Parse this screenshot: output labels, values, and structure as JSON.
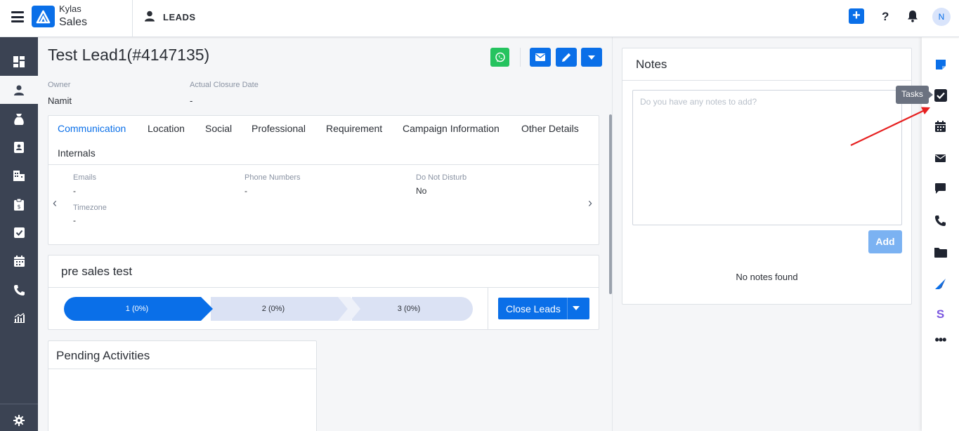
{
  "topbar": {
    "brand_line1": "Kylas",
    "brand_line2": "Sales",
    "module": "LEADS",
    "avatar_initial": "N"
  },
  "lead": {
    "title": "Test Lead1(#4147135)",
    "fields": [
      {
        "label": "Owner",
        "value": "Namit"
      },
      {
        "label": "Actual Closure Date",
        "value": "-"
      }
    ]
  },
  "tabs": [
    {
      "label": "Communication",
      "active": true
    },
    {
      "label": "Location"
    },
    {
      "label": "Social"
    },
    {
      "label": "Professional"
    },
    {
      "label": "Requirement"
    },
    {
      "label": "Campaign Information"
    },
    {
      "label": "Other Details"
    },
    {
      "label": "Internals"
    }
  ],
  "communication": [
    {
      "label": "Emails",
      "value": "-"
    },
    {
      "label": "Phone Numbers",
      "value": "-"
    },
    {
      "label": "Do Not Disturb",
      "value": "No"
    },
    {
      "label": "Timezone",
      "value": "-"
    }
  ],
  "pipeline": {
    "title": "pre sales test",
    "stages": [
      {
        "label": "1 (0%)",
        "active": true
      },
      {
        "label": "2 (0%)"
      },
      {
        "label": "3 (0%)"
      }
    ],
    "close_button": "Close Leads"
  },
  "pending": {
    "title": "Pending Activities"
  },
  "notes": {
    "title": "Notes",
    "placeholder": "Do you have any notes to add?",
    "add_button": "Add",
    "empty_text": "No notes found"
  },
  "rightrail": {
    "tooltip": "Tasks",
    "items": [
      "sticky-note-icon",
      "tasks-icon",
      "calendar-icon",
      "email-icon",
      "chat-icon",
      "phone-icon",
      "folder-icon",
      "marketing-icon",
      "s-icon",
      "more-icon"
    ]
  },
  "colors": {
    "primary": "#0a6fe8",
    "nav_bg": "#3b4353",
    "whatsapp": "#25c35f",
    "annotation_arrow": "#e62020"
  }
}
